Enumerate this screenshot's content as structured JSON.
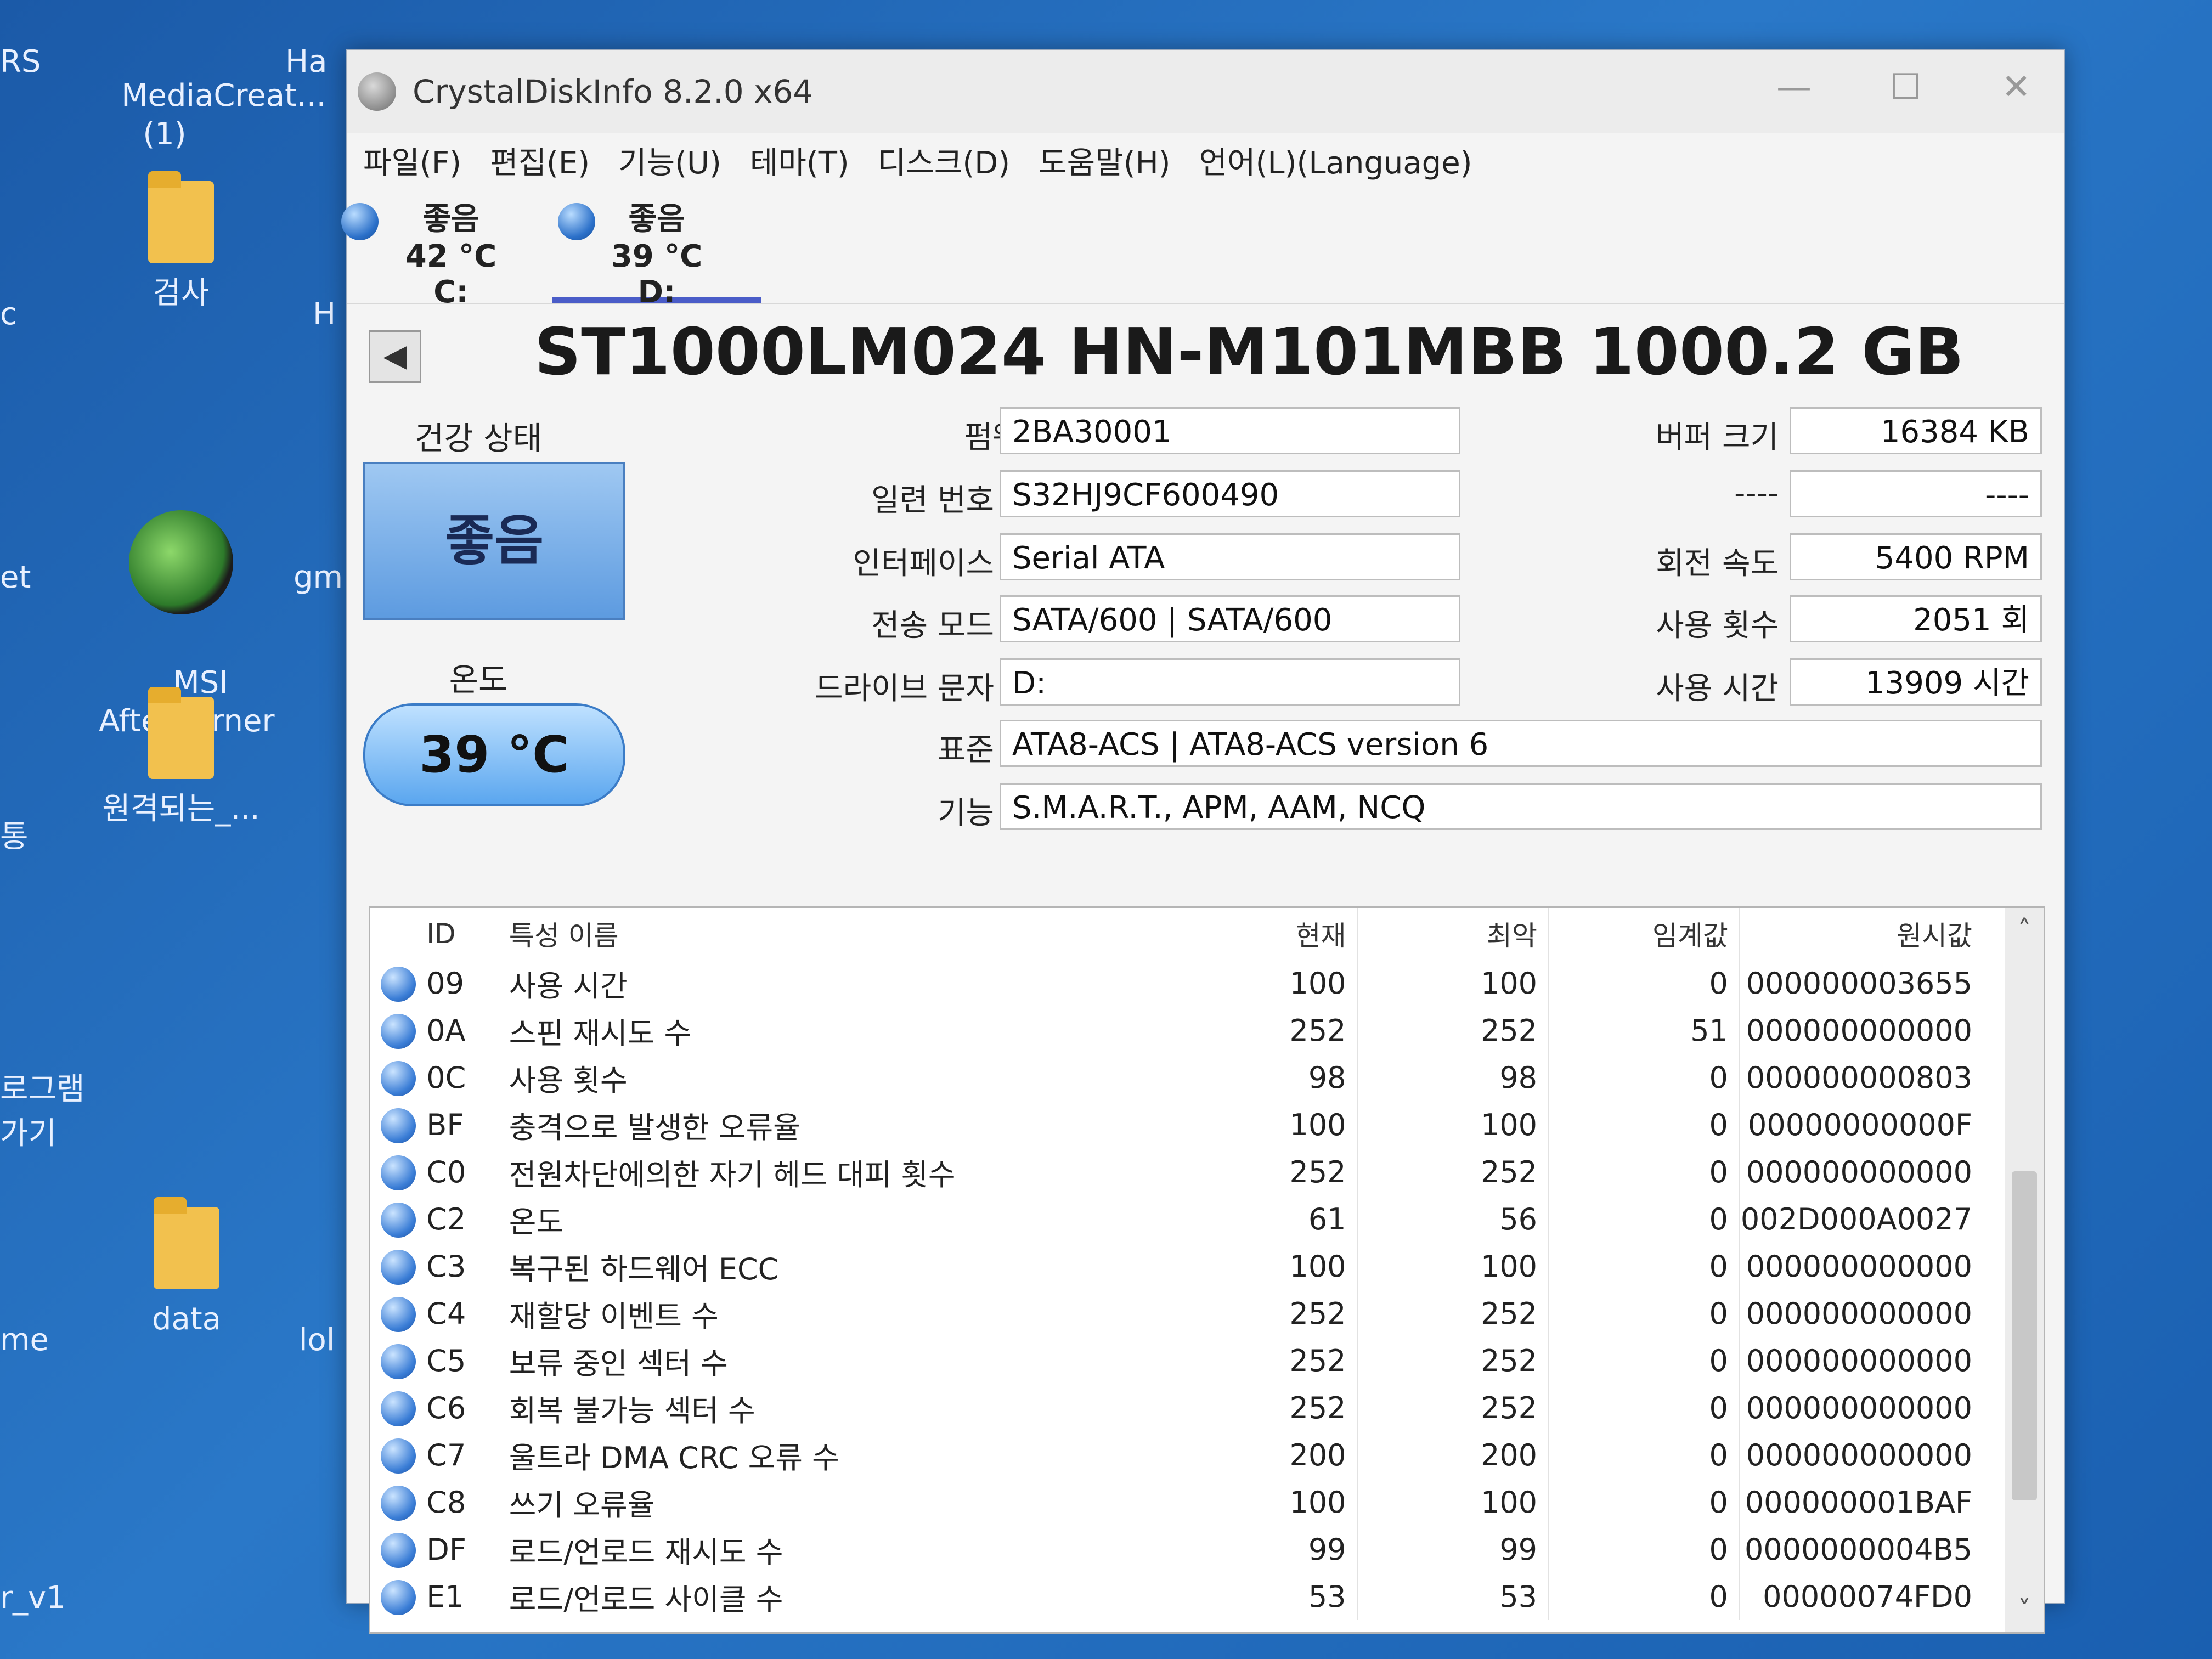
{
  "desktop": {
    "icons": [
      {
        "label": "MediaCreat...\n(1)"
      },
      {
        "label": "검사"
      },
      {
        "label": "MSI\nAfterburner"
      },
      {
        "label": "원격되는_..."
      },
      {
        "label": "data"
      }
    ],
    "edge_texts": [
      "RS",
      "Ha",
      "c",
      "et",
      "gm",
      "통",
      "로그램\n가기",
      "me",
      "lol",
      "r_v1",
      "H"
    ]
  },
  "window": {
    "title": "CrystalDiskInfo 8.2.0 x64",
    "minimize": "—",
    "maximize": "☐",
    "close": "✕"
  },
  "menu": [
    "파일(F)",
    "편집(E)",
    "기능(U)",
    "테마(T)",
    "디스크(D)",
    "도움말(H)",
    "언어(L)(Language)"
  ],
  "drives": [
    {
      "status": "좋음",
      "temp": "42 °C",
      "letter": "C:"
    },
    {
      "status": "좋음",
      "temp": "39 °C",
      "letter": "D:"
    }
  ],
  "disk": {
    "back_label": "◀",
    "model": "ST1000LM024 HN-M101MBB 1000.2 GB",
    "health_label": "건강 상태",
    "health_value": "좋음",
    "temp_label": "온도",
    "temp_value": "39 °C",
    "left_fields": [
      {
        "label": "펌웨어",
        "value": "2BA30001"
      },
      {
        "label": "일련 번호",
        "value": "S32HJ9CF600490"
      },
      {
        "label": "인터페이스",
        "value": "Serial ATA"
      },
      {
        "label": "전송 모드",
        "value": "SATA/600 | SATA/600"
      },
      {
        "label": "드라이브 문자",
        "value": "D:"
      }
    ],
    "right_fields": [
      {
        "label": "버퍼 크기",
        "value": "16384 KB"
      },
      {
        "label": "----",
        "value": "----"
      },
      {
        "label": "회전 속도",
        "value": "5400 RPM"
      },
      {
        "label": "사용 횟수",
        "value": "2051 회"
      },
      {
        "label": "사용 시간",
        "value": "13909 시간"
      }
    ],
    "standard_label": "표준",
    "standard_value": "ATA8-ACS | ATA8-ACS version 6",
    "features_label": "기능",
    "features_value": "S.M.A.R.T., APM, AAM, NCQ"
  },
  "smart": {
    "headers": {
      "id": "ID",
      "name": "특성 이름",
      "current": "현재",
      "worst": "최악",
      "threshold": "임계값",
      "raw": "원시값"
    },
    "rows": [
      {
        "id": "09",
        "name": "사용 시간",
        "current": "100",
        "worst": "100",
        "threshold": "0",
        "raw": "000000003655"
      },
      {
        "id": "0A",
        "name": "스핀 재시도 수",
        "current": "252",
        "worst": "252",
        "threshold": "51",
        "raw": "000000000000"
      },
      {
        "id": "0C",
        "name": "사용 횟수",
        "current": "98",
        "worst": "98",
        "threshold": "0",
        "raw": "000000000803"
      },
      {
        "id": "BF",
        "name": "충격으로 발생한 오류율",
        "current": "100",
        "worst": "100",
        "threshold": "0",
        "raw": "00000000000F"
      },
      {
        "id": "C0",
        "name": "전원차단에의한 자기 헤드 대피 횟수",
        "current": "252",
        "worst": "252",
        "threshold": "0",
        "raw": "000000000000"
      },
      {
        "id": "C2",
        "name": "온도",
        "current": "61",
        "worst": "56",
        "threshold": "0",
        "raw": "002D000A0027"
      },
      {
        "id": "C3",
        "name": "복구된 하드웨어 ECC",
        "current": "100",
        "worst": "100",
        "threshold": "0",
        "raw": "000000000000"
      },
      {
        "id": "C4",
        "name": "재할당 이벤트 수",
        "current": "252",
        "worst": "252",
        "threshold": "0",
        "raw": "000000000000"
      },
      {
        "id": "C5",
        "name": "보류 중인 섹터 수",
        "current": "252",
        "worst": "252",
        "threshold": "0",
        "raw": "000000000000"
      },
      {
        "id": "C6",
        "name": "회복 불가능 섹터 수",
        "current": "252",
        "worst": "252",
        "threshold": "0",
        "raw": "000000000000"
      },
      {
        "id": "C7",
        "name": "울트라 DMA CRC 오류 수",
        "current": "200",
        "worst": "200",
        "threshold": "0",
        "raw": "000000000000"
      },
      {
        "id": "C8",
        "name": "쓰기 오류율",
        "current": "100",
        "worst": "100",
        "threshold": "0",
        "raw": "000000001BAF"
      },
      {
        "id": "DF",
        "name": "로드/언로드 재시도 수",
        "current": "99",
        "worst": "99",
        "threshold": "0",
        "raw": "0000000004B5"
      },
      {
        "id": "E1",
        "name": "로드/언로드 사이클 수",
        "current": "53",
        "worst": "53",
        "threshold": "0",
        "raw": "00000074FD0"
      }
    ],
    "scroll_up": "˄",
    "scroll_down": "˅"
  },
  "colors": {
    "accent": "#4a5cc8",
    "health_good": "#5d9be0"
  },
  "icons": [
    "crystaldiskinfo-icon",
    "status-good-icon",
    "back-arrow-icon",
    "folder-icon"
  ]
}
